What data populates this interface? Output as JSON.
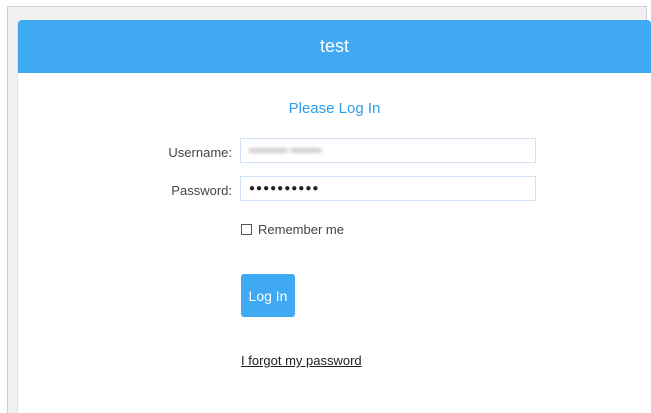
{
  "header": {
    "title": "test"
  },
  "form": {
    "subtitle": "Please Log In",
    "username_label": "Username:",
    "username_value": "•••••••••• ••••••••",
    "password_label": "Password:",
    "password_value": "●●●●●●●●●●",
    "remember_label": "Remember me",
    "remember_checked": false,
    "login_button_label": "Log In",
    "forgot_password_link": "I forgot my password"
  },
  "colors": {
    "accent": "#40a9f4",
    "subtitle": "#2d9ee6",
    "background": "#ffffff"
  }
}
